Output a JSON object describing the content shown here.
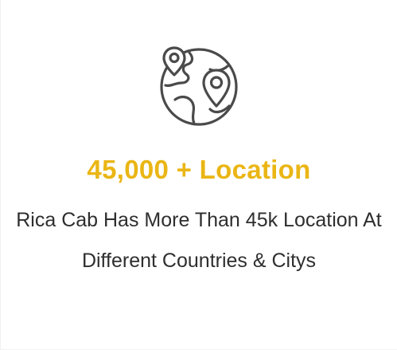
{
  "card": {
    "icon": "globe-location-pins-icon",
    "title": "45,000 + Location",
    "description": "Rica Cab Has More Than 45k Location At Different Countries & Citys"
  },
  "colors": {
    "accent": "#eab615",
    "icon_stroke": "#4a4a4a",
    "text": "#2e2e2e",
    "background": "#ffffff"
  }
}
